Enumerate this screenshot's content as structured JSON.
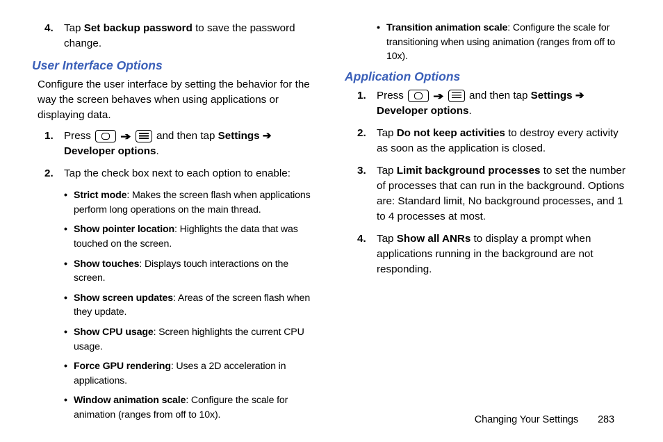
{
  "left": {
    "step4": {
      "num": "4.",
      "pre": "Tap ",
      "bold": "Set backup password",
      "post": " to save the password change."
    },
    "heading": "User Interface Options",
    "intro": "Configure the user interface by setting the behavior for the way the screen behaves when using applications or displaying data.",
    "step1": {
      "num": "1.",
      "press": "Press ",
      "andthen": " and then tap ",
      "settings": "Settings",
      "arrow2": " ➔ ",
      "dev": "Developer options",
      "dot": "."
    },
    "step2": {
      "num": "2.",
      "text": "Tap the check box next to each option to enable:"
    },
    "bullets": [
      {
        "bold": "Strict mode",
        "text": ": Makes the screen flash when applications perform long operations on the main thread."
      },
      {
        "bold": "Show pointer location",
        "text": ": Highlights the data that was touched on the screen."
      },
      {
        "bold": "Show touches",
        "text": ": Displays touch interactions on the screen."
      },
      {
        "bold": "Show screen updates",
        "text": ": Areas of the screen flash when they update."
      },
      {
        "bold": "Show CPU usage",
        "text": ": Screen highlights the current CPU usage."
      },
      {
        "bold": "Force GPU rendering",
        "text": ": Uses a 2D acceleration in applications."
      },
      {
        "bold": "Window animation scale",
        "text": ": Configure the scale for animation (ranges from off to 10x)."
      }
    ]
  },
  "right": {
    "bullet": {
      "bold": "Transition animation scale",
      "text": ": Configure the scale for transitioning when using animation (ranges from off to 10x)."
    },
    "heading": "Application Options",
    "step1": {
      "num": "1.",
      "press": "Press ",
      "andthen": " and then tap ",
      "settings": "Settings",
      "arrow2": " ➔ ",
      "dev": "Developer options",
      "dot": "."
    },
    "step2": {
      "num": "2.",
      "pre": "Tap ",
      "bold": "Do not keep activities",
      "post": " to destroy every activity as soon as the application is closed."
    },
    "step3": {
      "num": "3.",
      "pre": "Tap ",
      "bold": "Limit background processes",
      "post": " to set the number of processes that can run in the background. Options are: Standard limit, No background processes, and 1 to 4 processes at most."
    },
    "step4": {
      "num": "4.",
      "pre": "Tap ",
      "bold": "Show all ANRs",
      "post": " to display a prompt when applications running in the background are not responding."
    }
  },
  "footer": {
    "label": "Changing Your Settings",
    "page": "283"
  }
}
